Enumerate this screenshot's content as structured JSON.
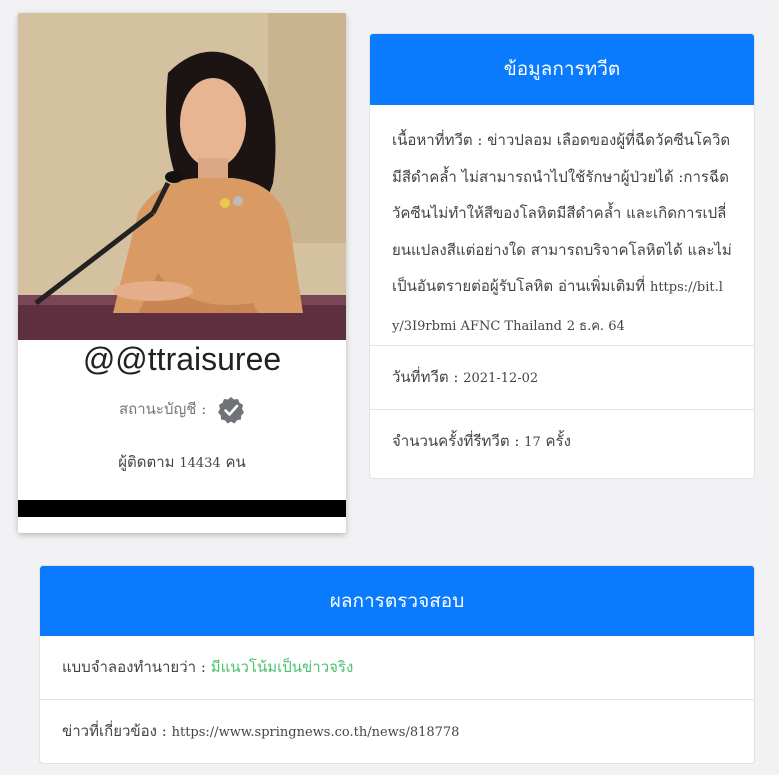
{
  "profile": {
    "username": "@@ttraisuree",
    "status_label": "สถานะบัญชี :",
    "verified_icon": "verified-badge-icon",
    "followers_label": "ผู้ติดตาม",
    "followers_count": "14434",
    "followers_unit": "คน"
  },
  "tweet_info": {
    "header": "ข้อมูลการทวีต",
    "content_label": "เนื้อหาที่ทวีต :",
    "content_text": "ข่าวปลอม เลือดของผู้ที่ฉีดวัคซีนโควิดมีสีดำคล้ำ ไม่สามารถนำไปใช้รักษาผู้ป่วยได้ :การฉีดวัคซีนไม่ทำให้สีของโลหิตมีสีดำคล้ำ และเกิดการเปลี่ยนแปลงสีแต่อย่างใด สามารถบริจาคโลหิตได้ และไม่เป็นอันตรายต่อผู้รับโลหิต อ่านเพิ่มเติมที่",
    "content_link": "https://bit.ly/3I9rbmi AFNC Thailand",
    "content_date": "2 ธ.ค. 64",
    "date_label": "วันที่ทวีต :",
    "date_value": "2021-12-02",
    "retweet_label": "จำนวนครั้งที่รีทวีต :",
    "retweet_count": "17",
    "retweet_unit": "ครั้ง"
  },
  "result": {
    "header": "ผลการตรวจสอบ",
    "prediction_label": "แบบจำลองทำนายว่า :",
    "prediction_value": "มีแนวโน้มเป็นข่าวจริง",
    "related_label": "ข่าวที่เกี่ยวข้อง :",
    "related_url": "https://www.springnews.co.th/news/818778"
  },
  "colors": {
    "accent": "#0a7bff",
    "prediction": "#4cc16e",
    "background": "#f2f2f4"
  }
}
